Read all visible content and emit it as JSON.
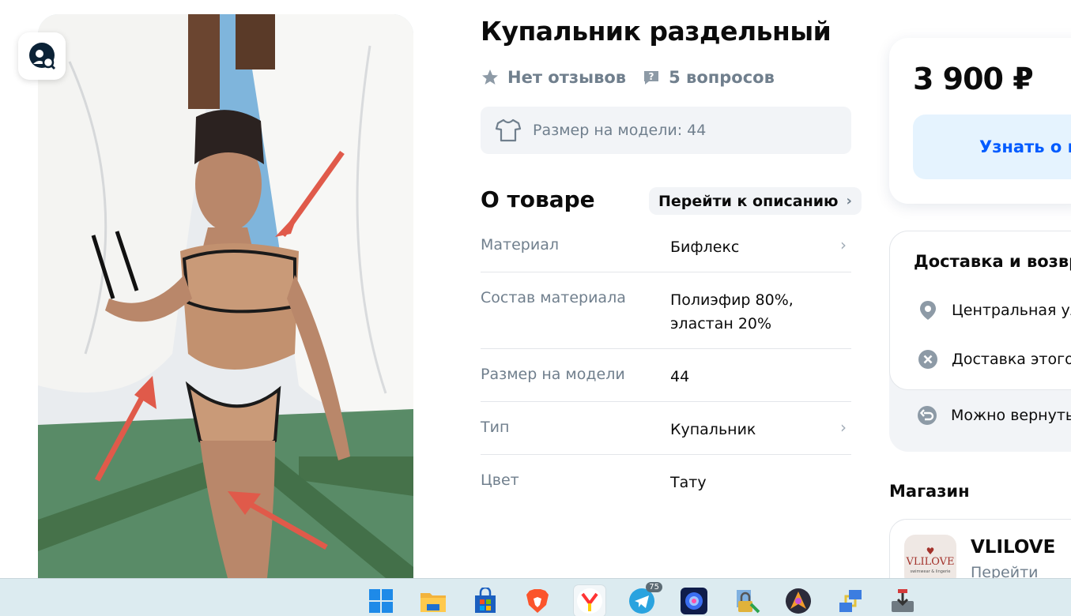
{
  "product": {
    "title": "Купальник раздельный",
    "reviews": "Нет отзывов",
    "questions": "5 вопросов",
    "model_size_chip": "Размер на модели: 44"
  },
  "about": {
    "title": "О товаре",
    "goto_description": "Перейти к описанию",
    "specs": [
      {
        "key": "Материал",
        "value": "Бифлекс",
        "has_chevron": true
      },
      {
        "key": "Состав материала",
        "value": "Полиэфир 80%,\nэластан 20%",
        "has_chevron": false
      },
      {
        "key": "Размер на модели",
        "value": "44",
        "has_chevron": false
      },
      {
        "key": "Тип",
        "value": "Купальник",
        "has_chevron": true
      },
      {
        "key": "Цвет",
        "value": "Тату",
        "has_chevron": false
      }
    ]
  },
  "price_card": {
    "price": "3 900 ₽",
    "learn_button": "Узнать о п"
  },
  "delivery": {
    "title": "Доставка и возвр",
    "rows": [
      "Центральная ул",
      "Доставка этого",
      "Можно вернуть"
    ]
  },
  "shop": {
    "section_title": "Магазин",
    "name": "VLILOVE",
    "link": "Перейти",
    "logo_text": "VLILOVE",
    "logo_subtext": "swimwear & lingerie"
  },
  "taskbar": {
    "telegram_badge": "75",
    "icons": [
      "windows-start-icon",
      "file-explorer-icon",
      "microsoft-store-icon",
      "brave-browser-icon",
      "yandex-browser-icon",
      "telegram-icon",
      "blue-flower-app-icon",
      "lock-app-icon",
      "navigator-app-icon",
      "network-app-icon",
      "installer-app-icon"
    ]
  },
  "colors": {
    "accent_blue": "#005bff",
    "learn_bg": "#e5f3fe",
    "muted_text": "#707f8d",
    "chip_bg": "#f2f4f7",
    "taskbar_bg": "#dcebf0"
  }
}
